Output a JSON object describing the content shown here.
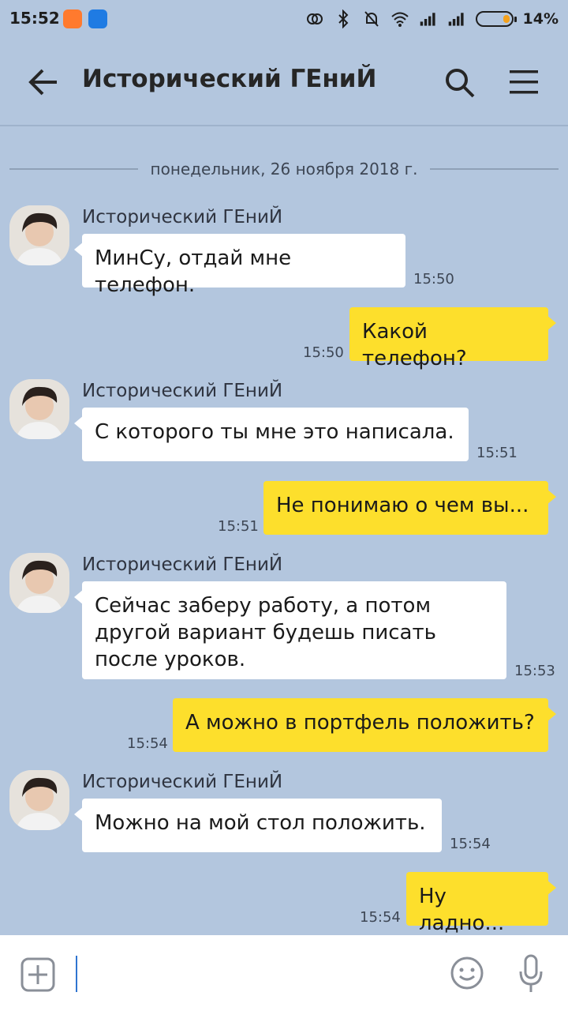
{
  "status_bar": {
    "time": "15:52",
    "battery_pct": "14%"
  },
  "header": {
    "title": "Исторический ГЕниЙ"
  },
  "date_separator": "понедельник, 26 ноября 2018 г.",
  "messages": [
    {
      "dir": "in",
      "sender": "Исторический ГЕниЙ",
      "text": "МинСу, отдай мне телефон.",
      "time": "15:50"
    },
    {
      "dir": "out",
      "text": "Какой телефон?",
      "time": "15:50"
    },
    {
      "dir": "in",
      "sender": "Исторический ГЕниЙ",
      "text": "С которого ты мне это написала.",
      "time": "15:51"
    },
    {
      "dir": "out",
      "text": "Не понимаю о чем вы...",
      "time": "15:51"
    },
    {
      "dir": "in",
      "sender": "Исторический ГЕниЙ",
      "text": "Сейчас заберу работу, а потом другой вариант будешь писать после уроков.",
      "time": "15:53"
    },
    {
      "dir": "out",
      "text": "А можно в портфель положить?",
      "time": "15:54"
    },
    {
      "dir": "in",
      "sender": "Исторический ГЕниЙ",
      "text": "Можно на мой стол положить.",
      "time": "15:54"
    },
    {
      "dir": "out",
      "text": "Ну ладно...",
      "time": "15:54"
    }
  ],
  "input": {
    "value": "",
    "placeholder": ""
  },
  "icons": {
    "back": "back-arrow-icon",
    "search": "search-icon",
    "menu": "menu-icon",
    "add": "plus-icon",
    "emoji": "emoji-icon",
    "mic": "microphone-icon"
  },
  "colors": {
    "background": "#b3c6de",
    "outgoing": "#fddf2c",
    "incoming": "#ffffff",
    "cursor": "#2f74d0"
  }
}
